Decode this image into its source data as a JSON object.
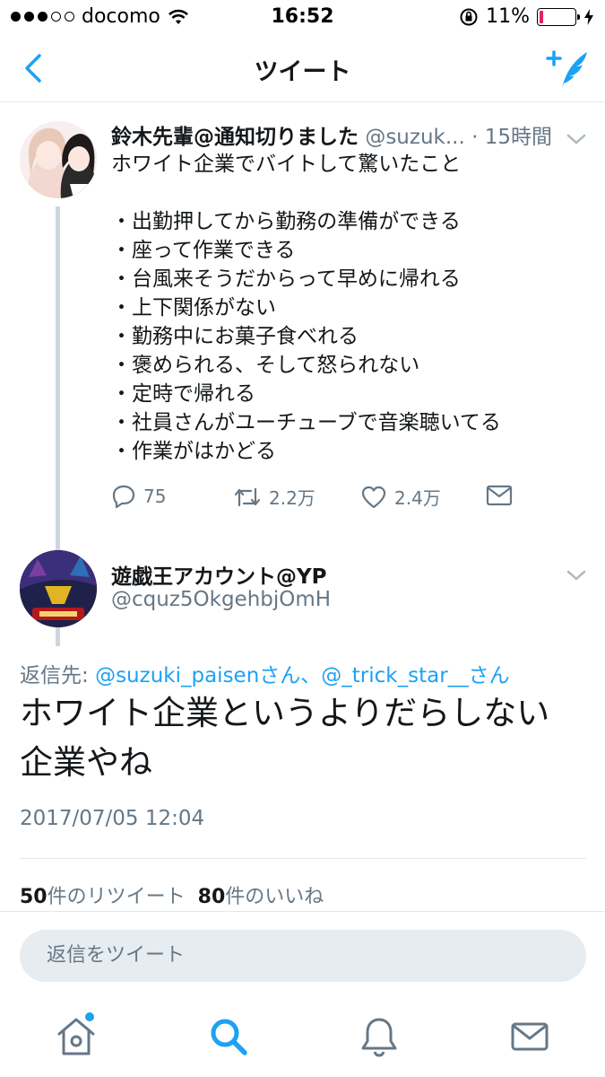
{
  "status_bar": {
    "carrier": "docomo",
    "time": "16:52",
    "battery_text": "11%",
    "battery_level": 0.11
  },
  "nav": {
    "title": "ツイート"
  },
  "parent_tweet": {
    "name": "鈴木先輩@通知切りました",
    "handle": "@suzuk...",
    "time_ago": "· 15時間",
    "lines": [
      "ホワイト企業でバイトして驚いたこと",
      "",
      "・出勤押してから勤務の準備ができる",
      "・座って作業できる",
      "・台風来そうだからって早めに帰れる",
      "・上下関係がない",
      "・勤務中にお菓子食べれる",
      "・褒められる、そして怒られない",
      "・定時で帰れる",
      "・社員さんがユーチューブで音楽聴いてる",
      "・作業がはかどる"
    ],
    "replies": "75",
    "retweets": "2.2万",
    "likes": "2.4万"
  },
  "reply_tweet": {
    "name": "遊戯王アカウント@YP",
    "handle": "@cquz5OkgehbjOmH",
    "reply_to_prefix": "返信先: ",
    "mention_1": "@suzuki_paisenさん",
    "separator": "、",
    "mention_2": "@_trick_star__さん",
    "text_line_1": "ホワイト企業というよりだらしない",
    "text_line_2": "企業やね",
    "timestamp": "2017/07/05 12:04",
    "retweet_count": "50",
    "retweet_label": "件のリツイート",
    "like_count": "80",
    "like_label": "件のいいね"
  },
  "reply_box": {
    "placeholder": "返信をツイート"
  },
  "colors": {
    "accent": "#1da1f2",
    "muted": "#657786",
    "text": "#14171a",
    "battery_low": "#e0245e"
  }
}
